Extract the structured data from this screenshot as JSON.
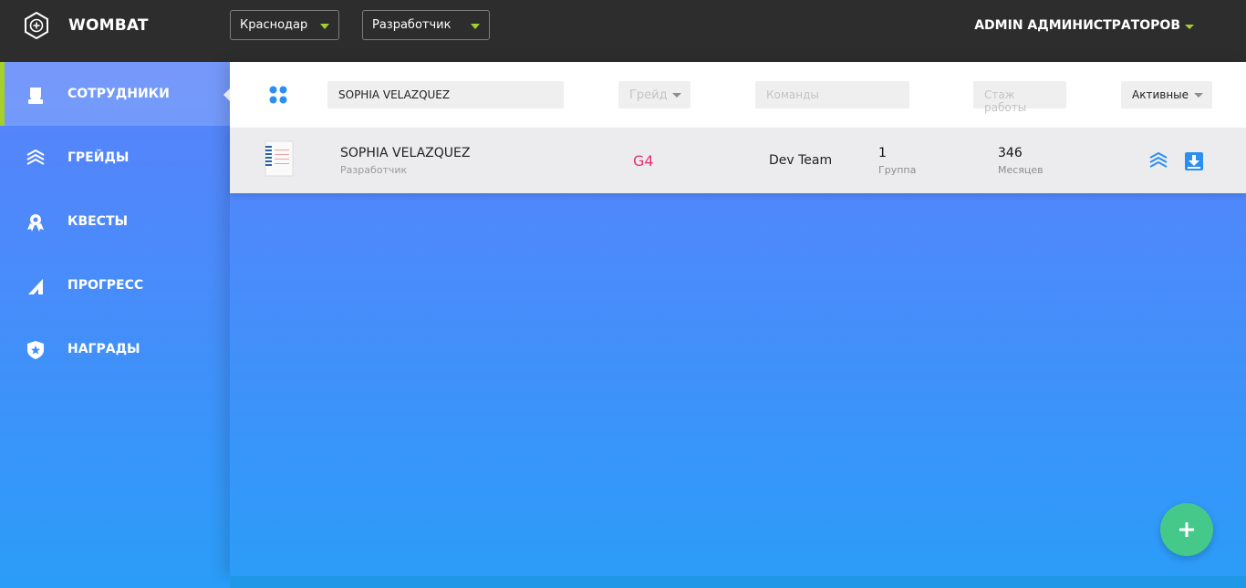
{
  "app": {
    "title": "WOMBAT"
  },
  "topbar": {
    "city_select": "Краснодар",
    "role_select": "Разработчик",
    "user_menu": "ADMIN АДМИНИСТРАТОРОВ"
  },
  "sidebar": {
    "items": [
      {
        "label": "СОТРУДНИКИ",
        "icon": "person-icon",
        "active": true
      },
      {
        "label": "ГРЕЙДЫ",
        "icon": "layers-icon",
        "active": false
      },
      {
        "label": "КВЕСТЫ",
        "icon": "award-icon",
        "active": false
      },
      {
        "label": "ПРОГРЕСС",
        "icon": "progress-icon",
        "active": false
      },
      {
        "label": "НАГРАДЫ",
        "icon": "shield-star-icon",
        "active": false
      }
    ]
  },
  "filters": {
    "search_value": "SOPHIA VELAZQUEZ",
    "grade_placeholder": "Грейд",
    "teams_placeholder": "Команды",
    "experience_placeholder": "Стаж работы",
    "status_select": "Активные"
  },
  "employees": [
    {
      "name": "SOPHIA VELAZQUEZ",
      "role": "Разработчик",
      "grade": "G4",
      "team": "Dev Team",
      "group_value": "1",
      "group_label": "Группа",
      "months_value": "346",
      "months_label": "Месяцев"
    }
  ],
  "colors": {
    "topbar": "#2d2d2d",
    "accent": "#a6cf2b",
    "grade": "#e4316b",
    "fab": "#45c98a",
    "icon_blue": "#2b8ff0"
  }
}
